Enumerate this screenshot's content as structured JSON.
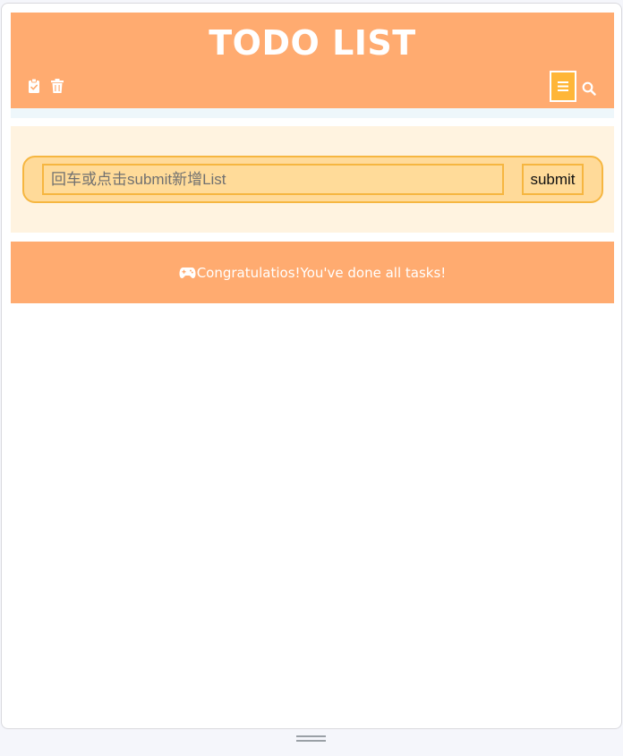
{
  "header": {
    "title": "TODO LIST"
  },
  "input": {
    "placeholder": "回车或点击submit新增List",
    "submit_label": "submit"
  },
  "status": {
    "message": "Congratulatios!You've done all tasks!"
  },
  "icons": {
    "select_all": "clipboard-check-icon",
    "delete": "trash-icon",
    "menu": "menu-icon",
    "search": "search-icon",
    "status": "gamepad-icon",
    "resize": "resize-handle-icon"
  },
  "colors": {
    "header_bg": "#ffab70",
    "input_panel_bg": "#fff3e0",
    "input_bg": "#ffda99",
    "input_border": "#f6b640",
    "menu_button_bg": "#ffb638",
    "text_on_accent": "#ffffff"
  }
}
